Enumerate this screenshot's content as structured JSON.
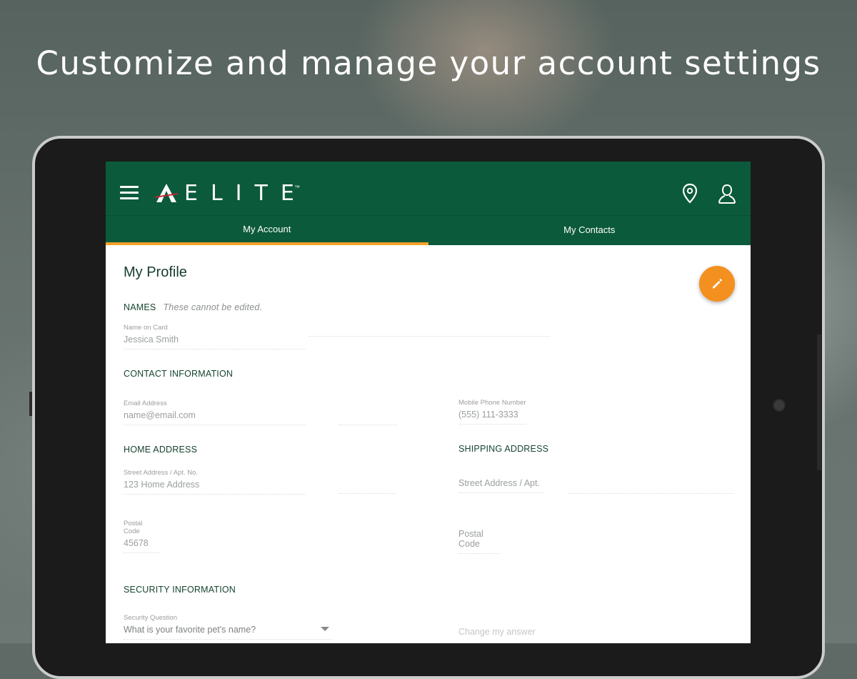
{
  "headline": "Customize and manage your account settings",
  "app": {
    "logo_text": "ELITE",
    "logo_tm": "™",
    "icons": {
      "menu": "hamburger-menu-icon",
      "location": "location-pin-icon",
      "profile": "user-profile-icon",
      "edit": "pencil-icon"
    }
  },
  "tabs": [
    {
      "label": "My Account",
      "active": true
    },
    {
      "label": "My Contacts",
      "active": false
    }
  ],
  "profile": {
    "title": "My Profile",
    "names": {
      "heading": "NAMES",
      "note": "These cannot be edited.",
      "name_on_card_label": "Name on Card",
      "name_on_card_value": "Jessica Smith"
    },
    "contact": {
      "heading": "CONTACT INFORMATION",
      "email_label": "Email Address",
      "email_value": "name@email.com",
      "phone_label": "Mobile Phone Number",
      "phone_value": "(555) 111-3333"
    },
    "home_address": {
      "heading": "HOME ADDRESS",
      "street_label": "Street Address / Apt. No.",
      "street_value": "123 Home Address",
      "postal_label": "Postal Code",
      "postal_value": "45678"
    },
    "shipping_address": {
      "heading": "SHIPPING ADDRESS",
      "street_placeholder": "Street Address / Apt.",
      "postal_placeholder": "Postal Code"
    },
    "security": {
      "heading": "SECURITY INFORMATION",
      "question_label": "Security Question",
      "question_value": "What is your favorite pet's name?",
      "answer_placeholder": "Change my answer"
    }
  },
  "colors": {
    "brand_green": "#0b5a3b",
    "accent_orange": "#f3901f",
    "tab_indicator": "#f5a12a"
  }
}
